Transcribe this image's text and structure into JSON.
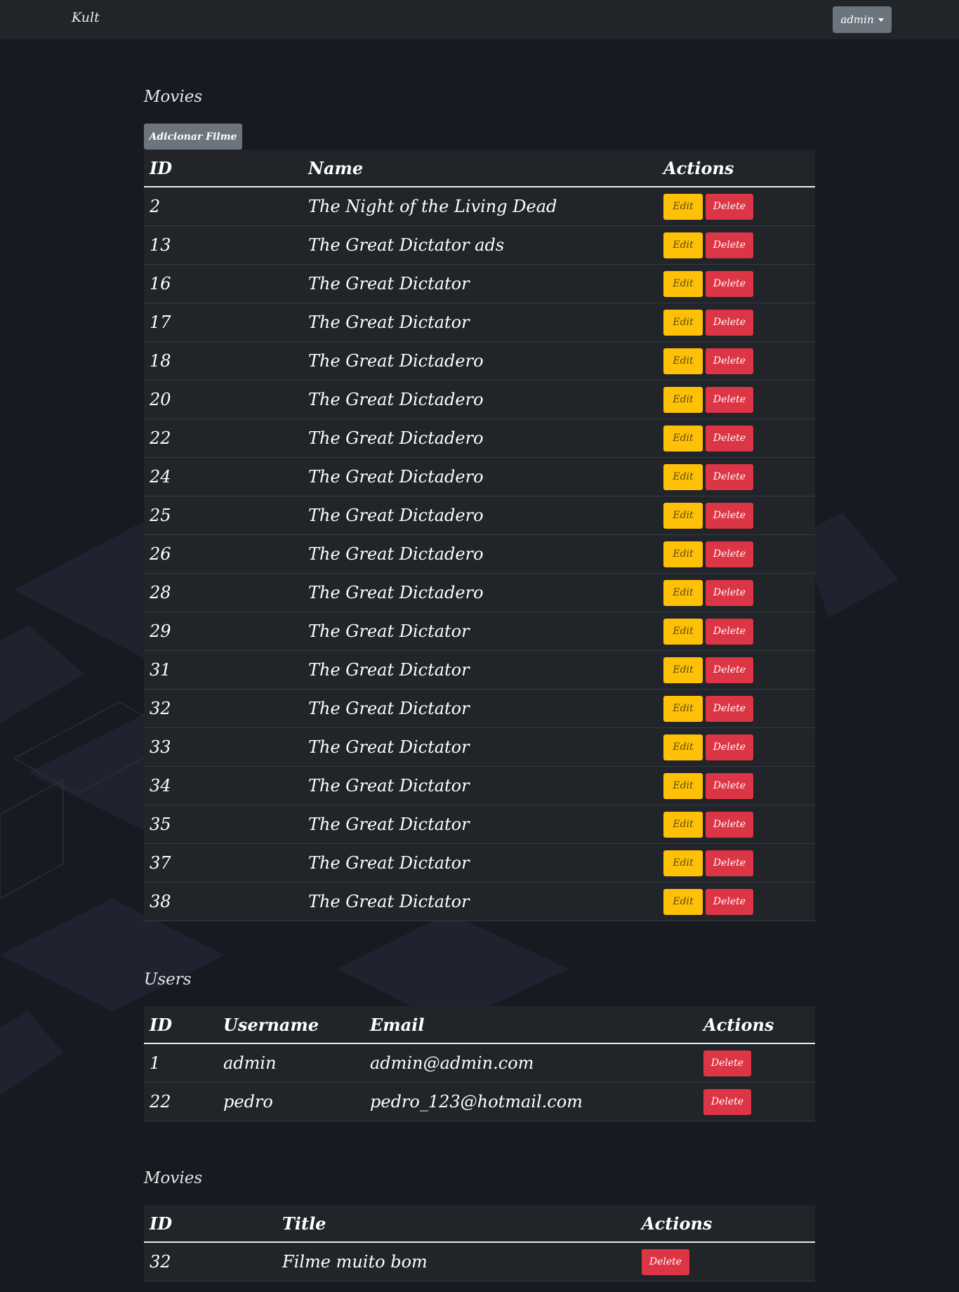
{
  "navbar": {
    "brand": "Kult",
    "user_menu": "admin"
  },
  "movies_section": {
    "title": "Movies",
    "add_button": "Adicionar Filme",
    "headers": [
      "ID",
      "Name",
      "Actions"
    ],
    "rows": [
      {
        "id": "2",
        "name": "The Night of the Living Dead"
      },
      {
        "id": "13",
        "name": "The Great Dictator ads"
      },
      {
        "id": "16",
        "name": "The Great Dictator"
      },
      {
        "id": "17",
        "name": "The Great Dictator"
      },
      {
        "id": "18",
        "name": "The Great Dictadero"
      },
      {
        "id": "20",
        "name": "The Great Dictadero"
      },
      {
        "id": "22",
        "name": "The Great Dictadero"
      },
      {
        "id": "24",
        "name": "The Great Dictadero"
      },
      {
        "id": "25",
        "name": "The Great Dictadero"
      },
      {
        "id": "26",
        "name": "The Great Dictadero"
      },
      {
        "id": "28",
        "name": "The Great Dictadero"
      },
      {
        "id": "29",
        "name": "The Great Dictator"
      },
      {
        "id": "31",
        "name": "The Great Dictator"
      },
      {
        "id": "32",
        "name": "The Great Dictator"
      },
      {
        "id": "33",
        "name": "The Great Dictator"
      },
      {
        "id": "34",
        "name": "The Great Dictator"
      },
      {
        "id": "35",
        "name": "The Great Dictator"
      },
      {
        "id": "37",
        "name": "The Great Dictator"
      },
      {
        "id": "38",
        "name": "The Great Dictator"
      }
    ],
    "edit_label": "Edit",
    "delete_label": "Delete"
  },
  "users_section": {
    "title": "Users",
    "headers": [
      "ID",
      "Username",
      "Email",
      "Actions"
    ],
    "rows": [
      {
        "id": "1",
        "username": "admin",
        "email": "admin@admin.com"
      },
      {
        "id": "22",
        "username": "pedro",
        "email": "pedro_123@hotmail.com"
      }
    ],
    "delete_label": "Delete"
  },
  "reviews_section": {
    "title": "Movies",
    "headers": [
      "ID",
      "Title",
      "Actions"
    ],
    "rows": [
      {
        "id": "32",
        "title": "Filme muito bom"
      }
    ],
    "delete_label": "Delete"
  },
  "colors": {
    "background": "#181a22",
    "navbar": "#212429",
    "table": "#212429",
    "secondary": "#6c757d",
    "warning": "#ffc107",
    "danger": "#dc3545"
  }
}
